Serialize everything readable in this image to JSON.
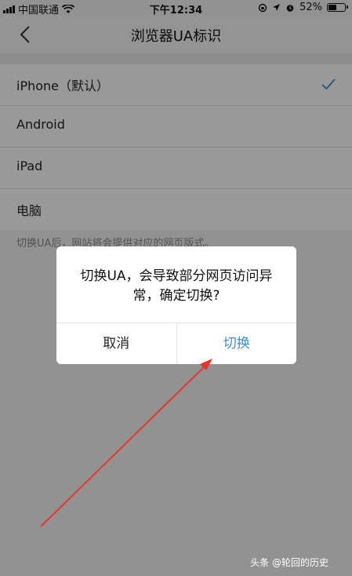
{
  "status_bar": {
    "carrier": "中国联通",
    "time": "下午12:34",
    "battery": "52%",
    "battery_level": 0.52
  },
  "header": {
    "title": "浏览器UA标识"
  },
  "ua_options": [
    {
      "label": "iPhone（默认）",
      "selected": true
    },
    {
      "label": "Android",
      "selected": false
    },
    {
      "label": "iPad",
      "selected": false
    },
    {
      "label": "电脑",
      "selected": false
    }
  ],
  "hint": "切换UA后，网站将会提供对应的网页版式。",
  "dialog": {
    "message": "切换UA，会导致部分网页访问异常，确定切换?",
    "cancel_label": "取消",
    "confirm_label": "切换"
  },
  "watermark": "头条 @轮回的历史",
  "colors": {
    "accent": "#3a8fd6",
    "annotation_arrow": "#e8352b"
  },
  "icons": {
    "back": "chevron-left-icon",
    "selected": "checkmark-icon",
    "wifi": "wifi-icon",
    "battery": "battery-icon"
  }
}
